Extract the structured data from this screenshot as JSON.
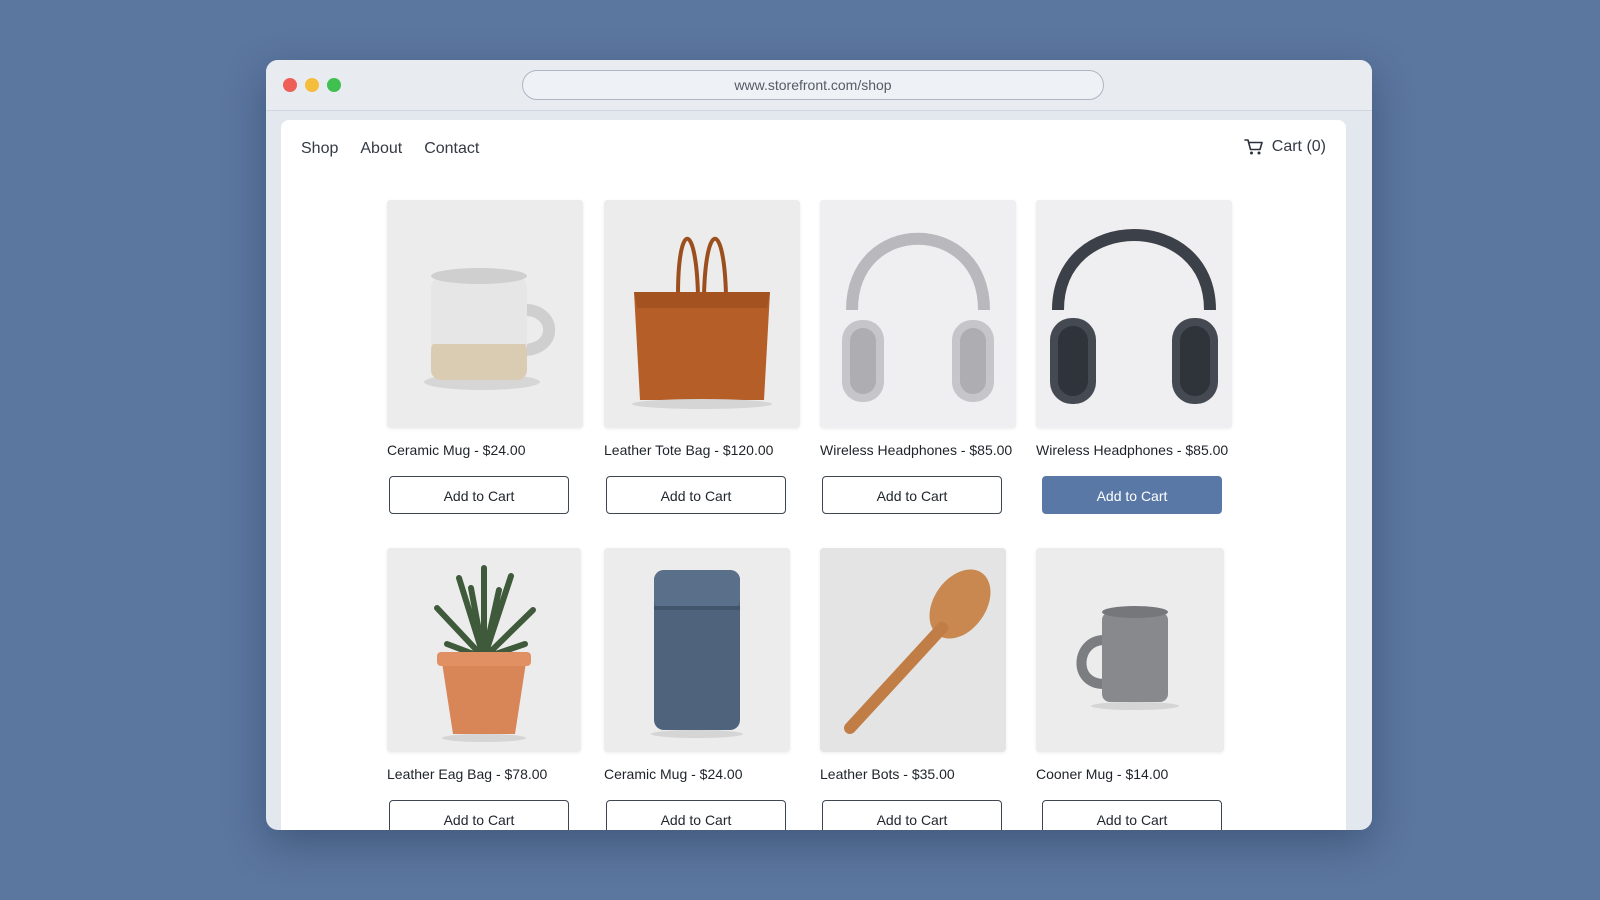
{
  "browser": {
    "url": "www.storefront.com/shop"
  },
  "nav": {
    "items": [
      {
        "label": "Shop"
      },
      {
        "label": "About"
      },
      {
        "label": "Contact"
      }
    ],
    "cart_label": "Cart (0)"
  },
  "products": [
    {
      "caption": "Ceramic Mug - $24.00",
      "button": "Add to Cart",
      "icon": "ceramic-mug-image"
    },
    {
      "caption": "Leather Tote Bag - $120.00",
      "button": "Add to Cart",
      "icon": "leather-tote-bag-image"
    },
    {
      "caption": "Wireless Headphones - $85.00",
      "button": "Add to Cart",
      "icon": "silver-headphones-image"
    },
    {
      "caption": "Wireless Headphones - $85.00",
      "button": "Add to Cart",
      "icon": "dark-headphones-image",
      "button_active": true
    },
    {
      "caption": "Leather Eag Bag - $78.00",
      "button": "Add to Cart",
      "icon": "potted-plant-image"
    },
    {
      "caption": "Ceramic Mug - $24.00",
      "button": "Add to Cart",
      "icon": "blue-canister-image"
    },
    {
      "caption": "Leather Bots - $35.00",
      "button": "Add to Cart",
      "icon": "wooden-spoon-image"
    },
    {
      "caption": "Cooner Mug - $14.00",
      "button": "Add to Cart",
      "icon": "gray-mug-image"
    }
  ],
  "colors": {
    "desktop_background": "#5b769f",
    "active_button": "#5a78a6"
  }
}
